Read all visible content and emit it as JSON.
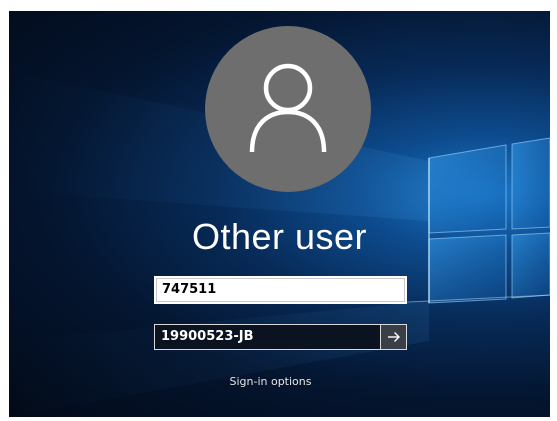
{
  "user": {
    "display_name": "Other user",
    "avatar_icon": "person-outline-icon"
  },
  "login_form": {
    "username_value": "747511",
    "password_value": "19900523-JB",
    "submit_icon": "arrow-right-icon",
    "sign_in_options_label": "Sign-in options"
  },
  "colors": {
    "avatar_background": "#6e6e6e",
    "wallpaper_accent": "#1a78c9"
  }
}
